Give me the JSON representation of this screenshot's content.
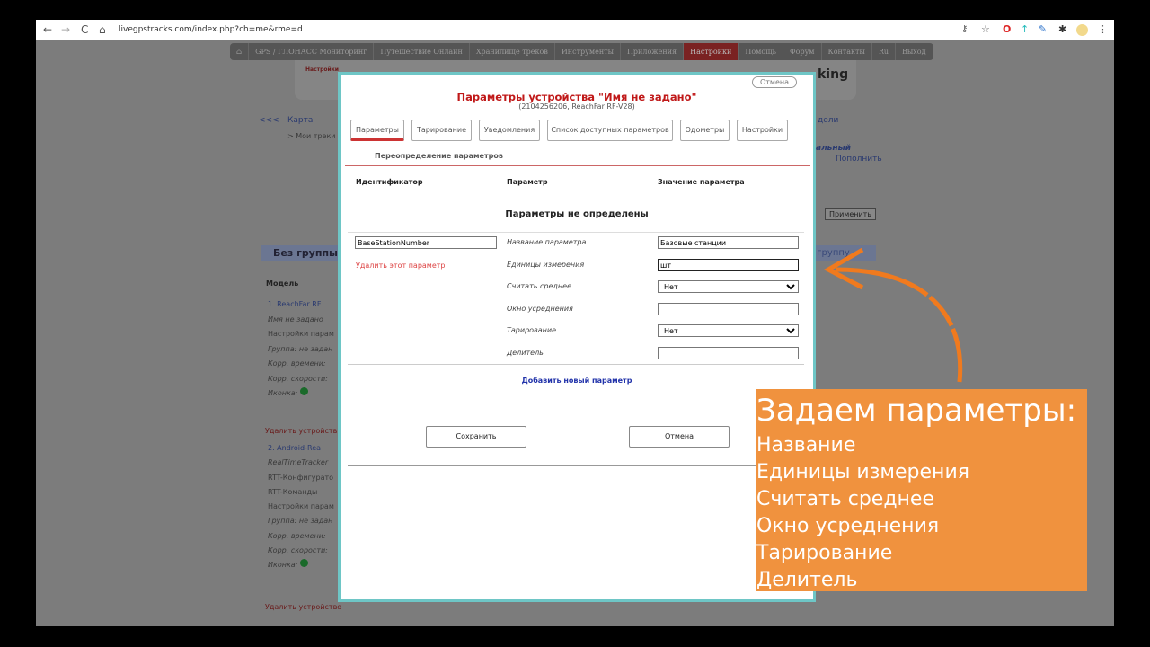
{
  "browser": {
    "url": "livegpstracks.com/index.php?ch=me&rme=d",
    "back": "←",
    "forward": "→",
    "reload": "C",
    "home": "⌂"
  },
  "topnav": [
    "GPS / ГЛОНАСС Мониторинг",
    "Путешествие Онлайн",
    "Хранилище треков",
    "Инструменты",
    "Приложения",
    "Настройки",
    "Помощь",
    "Форум",
    "Контакты",
    "Ru",
    "Выход"
  ],
  "background": {
    "settings_link": "Настройки",
    "logo": "king",
    "nav_back": "<<<",
    "nav_map": "Карта",
    "nav_models": "дели",
    "my_tracks": "> Мои треки",
    "tariff": "альный",
    "topup": "Пополнить",
    "apply": "Применить",
    "group": "Без группы",
    "group_right": "о группу",
    "model_header": "Модель",
    "device1": {
      "title": "1.  ReachFar RF",
      "name": "Имя не задано",
      "settings": "Настройки парам",
      "group": "Группа: не задан",
      "time": "Корр. времени: ",
      "speed": "Корр. скорости: ",
      "icon": "Иконка:",
      "delete": "Удалить устройств"
    },
    "device2": {
      "title": "2.  Android-Rea",
      "name": "RealTimeTracker",
      "config": "RTT-Конфигурато",
      "cmds": "RTT-Команды",
      "settings": "Настройки парам",
      "group": "Группа: не задан",
      "time": "Корр. времени: ",
      "speed": "Корр. скорости: ",
      "icon": "Иконка:",
      "delete": "Удалить устройство"
    }
  },
  "modal": {
    "title": "Параметры устройства \"Имя не задано\"",
    "subtitle": "(2104256206, ReachFar RF-V28)",
    "cancel_top": "Отмена",
    "tabs": [
      "Параметры",
      "Тарирование",
      "Уведомления",
      "Список доступных параметров",
      "Одометры",
      "Настройки"
    ],
    "subtab": "Переопределение параметров",
    "columns": [
      "Идентификатор",
      "Параметр",
      "Значение параметра"
    ],
    "empty": "Параметры не определены",
    "identifier": "BaseStationNumber",
    "delete_param": "Удалить этот параметр",
    "fields": [
      {
        "label": "Название параметра",
        "value": "Базовые станции"
      },
      {
        "label": "Единицы измерения",
        "value": "шт"
      },
      {
        "label": "Считать среднее",
        "value": "Нет"
      },
      {
        "label": "Окно усреднения",
        "value": ""
      },
      {
        "label": "Тарирование",
        "value": "Нет"
      },
      {
        "label": "Делитель",
        "value": ""
      }
    ],
    "add_param": "Добавить новый параметр",
    "save": "Сохранить",
    "cancel": "Отмена"
  },
  "callout": {
    "heading": "Задаем параметры:",
    "items": [
      "Название",
      "Единицы измерения",
      "Считать среднее",
      "Окно усреднения",
      "Тарирование",
      "Делитель"
    ],
    "color": "#f0923e"
  }
}
